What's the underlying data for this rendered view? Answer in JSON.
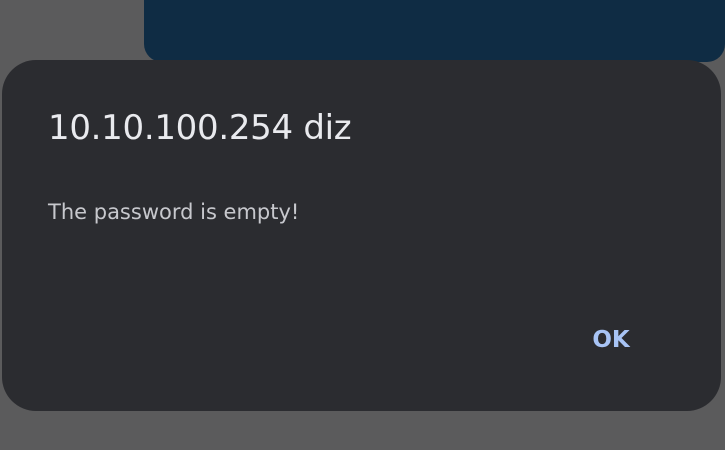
{
  "dialog": {
    "title": "10.10.100.254 diz",
    "message": "The password is empty!",
    "ok_label": "OK"
  },
  "colors": {
    "scrim": "#5b5b5c",
    "background_panel": "#0f2c44",
    "dialog_surface": "#2b2c30",
    "title_text": "#e9eaee",
    "message_text": "#c7c8cd",
    "button_text": "#a8c4f5"
  }
}
